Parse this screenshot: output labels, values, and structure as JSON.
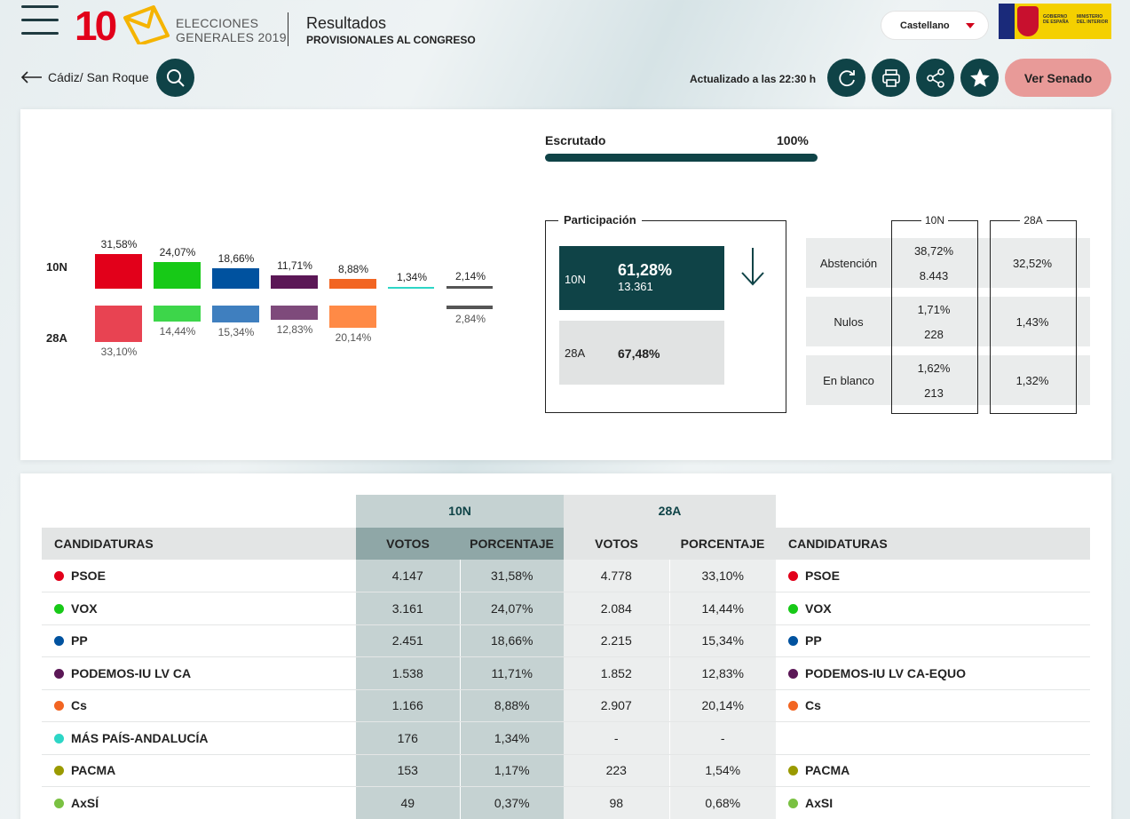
{
  "header": {
    "logo_number": "10",
    "logo_line1": "ELECCIONES",
    "logo_line2": "GENERALES 2019",
    "title": "Resultados",
    "subtitle": "PROVISIONALES AL CONGRESO",
    "language": "Castellano",
    "gov_text1": "GOBIERNO DE ESPAÑA",
    "gov_text2": "MINISTERIO DEL INTERIOR"
  },
  "toolbar": {
    "location": "Cádiz/ San Roque",
    "updated": "Actualizado a las 22:30 h",
    "senado_label": "Ver Senado"
  },
  "summary": {
    "row_10n": "10N",
    "row_28a": "28A",
    "parties": [
      {
        "color": "#e2001a",
        "color28": "#e84352",
        "pct10": "31,58%",
        "pct28": "33,10%"
      },
      {
        "color": "#17c917",
        "color28": "#3dd64a",
        "pct10": "24,07%",
        "pct28": "14,44%"
      },
      {
        "color": "#00529f",
        "color28": "#3f7fbf",
        "pct10": "18,66%",
        "pct28": "15,34%"
      },
      {
        "color": "#5b1756",
        "color28": "#7e4a7b",
        "pct10": "11,71%",
        "pct28": "12,83%"
      },
      {
        "color": "#f26522",
        "color28": "#ff8a46",
        "pct10": "8,88%",
        "pct28": "20,14%"
      },
      {
        "color": "#2dd6c6",
        "color28": "",
        "pct10": "1,34%",
        "pct28": ""
      },
      {
        "color": "#555555",
        "color28": "#555555",
        "pct10": "2,14%",
        "pct28": "2,84%"
      }
    ],
    "escrutado_label": "Escrutado",
    "escrutado_value": "100%",
    "escrutado_fraction": 1.0,
    "participacion_label": "Participación",
    "part_10n_label": "10N",
    "part_10n_pct": "61,28%",
    "part_10n_votes": "13.361",
    "part_28a_label": "28A",
    "part_28a_pct": "67,48%",
    "col_10n": "10N",
    "col_28a": "28A",
    "stats": [
      {
        "label": "Abstención",
        "pct10": "38,72%",
        "num10": "8.443",
        "pct28": "32,52%"
      },
      {
        "label": "Nulos",
        "pct10": "1,71%",
        "num10": "228",
        "pct28": "1,43%"
      },
      {
        "label": "En blanco",
        "pct10": "1,62%",
        "num10": "213",
        "pct28": "1,32%"
      }
    ]
  },
  "table": {
    "group_10n": "10N",
    "group_28a": "28A",
    "col_candidaturas": "CANDIDATURAS",
    "col_votos": "VOTOS",
    "col_porcentaje": "PORCENTAJE",
    "rows": [
      {
        "dot": "#e2001a",
        "name": "PSOE",
        "v10": "4.147",
        "p10": "31,58%",
        "v28": "4.778",
        "p28": "33,10%",
        "dot2": "#e2001a",
        "name2": "PSOE"
      },
      {
        "dot": "#17c917",
        "name": "VOX",
        "v10": "3.161",
        "p10": "24,07%",
        "v28": "2.084",
        "p28": "14,44%",
        "dot2": "#17c917",
        "name2": "VOX"
      },
      {
        "dot": "#00529f",
        "name": "PP",
        "v10": "2.451",
        "p10": "18,66%",
        "v28": "2.215",
        "p28": "15,34%",
        "dot2": "#00529f",
        "name2": "PP"
      },
      {
        "dot": "#5b1756",
        "name": "PODEMOS-IU LV CA",
        "v10": "1.538",
        "p10": "11,71%",
        "v28": "1.852",
        "p28": "12,83%",
        "dot2": "#5b1756",
        "name2": "PODEMOS-IU LV CA-EQUO"
      },
      {
        "dot": "#f26522",
        "name": "Cs",
        "v10": "1.166",
        "p10": "8,88%",
        "v28": "2.907",
        "p28": "20,14%",
        "dot2": "#f26522",
        "name2": "Cs"
      },
      {
        "dot": "#2dd6c6",
        "name": "MÁS PAÍS-ANDALUCÍA",
        "v10": "176",
        "p10": "1,34%",
        "v28": "-",
        "p28": "-",
        "dot2": "",
        "name2": ""
      },
      {
        "dot": "#9a9a00",
        "name": "PACMA",
        "v10": "153",
        "p10": "1,17%",
        "v28": "223",
        "p28": "1,54%",
        "dot2": "#9a9a00",
        "name2": "PACMA"
      },
      {
        "dot": "#7ac142",
        "name": "AxSÍ",
        "v10": "49",
        "p10": "0,37%",
        "v28": "98",
        "p28": "0,68%",
        "dot2": "#7ac142",
        "name2": "AxSI"
      }
    ]
  }
}
